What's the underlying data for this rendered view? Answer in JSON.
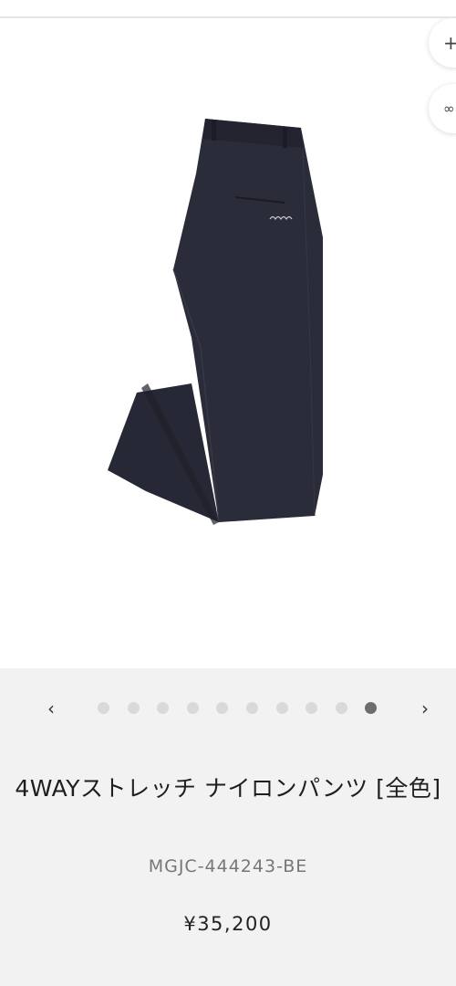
{
  "header": {},
  "image_controls": {
    "zoom_icon": "plus-icon",
    "zoom_glyph": "+",
    "ar_icon": "infinity-icon",
    "ar_glyph": "∞"
  },
  "carousel": {
    "prev_glyph": "‹",
    "next_glyph": "›",
    "dot_count": 10,
    "active_index": 9
  },
  "product": {
    "title": "4WAYストレッチ ナイロンパンツ [全色]",
    "sku": "MGJC-444243-BE",
    "price": "¥35,200"
  },
  "colors": {
    "background": "#f2f2f2",
    "dot_inactive": "#d9d9d9",
    "dot_active": "#6d6d6d",
    "pants": "#2b2c39"
  }
}
